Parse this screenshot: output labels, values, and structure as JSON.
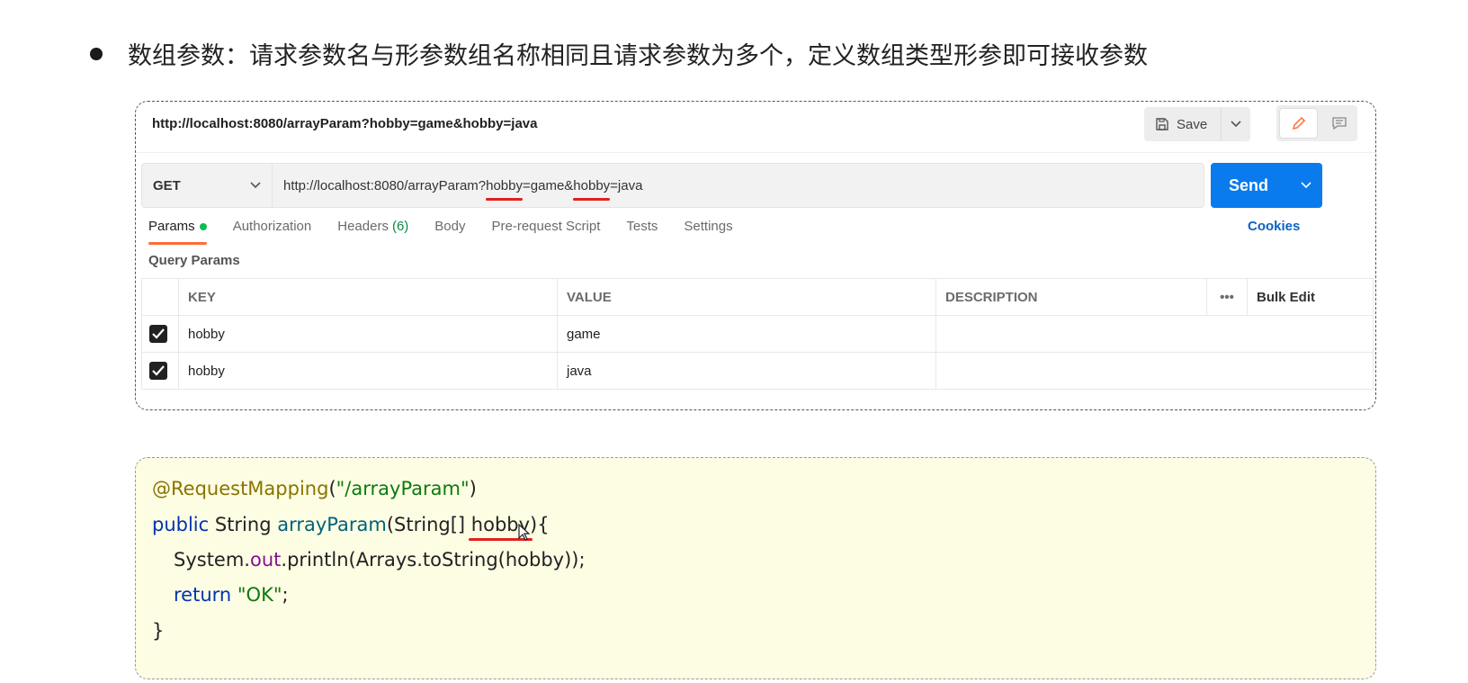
{
  "heading": {
    "text": "数组参数：请求参数名与形参数组名称相同且请求参数为多个，定义数组类型形参即可接收参数"
  },
  "postman": {
    "title_url": "http://localhost:8080/arrayParam?hobby=game&hobby=java",
    "save_label": "Save",
    "method": "GET",
    "url_parts": {
      "prefix": "http://localhost:8080/arrayParam?",
      "key1": "hobby",
      "mid": "=game&",
      "key2": "hobby",
      "suffix": "=java"
    },
    "send_label": "Send",
    "tabs": {
      "params": "Params",
      "authorization": "Authorization",
      "headers": "Headers",
      "headers_count": "(6)",
      "body": "Body",
      "prerequest": "Pre-request Script",
      "tests": "Tests",
      "settings": "Settings"
    },
    "cookies_label": "Cookies",
    "query_params_label": "Query Params",
    "table": {
      "headers": {
        "key": "KEY",
        "value": "VALUE",
        "description": "DESCRIPTION",
        "more": "•••",
        "bulk_edit": "Bulk Edit"
      },
      "rows": [
        {
          "key": "hobby",
          "value": "game",
          "description": "",
          "checked": true
        },
        {
          "key": "hobby",
          "value": "java",
          "description": "",
          "checked": true
        }
      ]
    },
    "colors": {
      "send": "#097bed",
      "active_tab": "#ff6c37",
      "params_dot": "#0cbb52",
      "cookies": "#0b62c4"
    }
  },
  "code": {
    "l1": {
      "anno": "@RequestMapping",
      "open": "(",
      "str": "\"/arrayParam\"",
      "close": ")"
    },
    "l2": {
      "kw": "public",
      "type": " String ",
      "fn": "arrayParam",
      "pre": "(String[] ",
      "param": "hobby",
      "post": "){"
    },
    "l3": {
      "pre": "System.",
      "field": "out",
      "post": ".println(Arrays.toString(hobby));"
    },
    "l4": {
      "kw": "return ",
      "str": "\"OK\"",
      "post": ";"
    },
    "l5": {
      "text": "}"
    },
    "colors": {
      "background": "#fdfde4",
      "annotation": "#8a7400",
      "string": "#0d7a0d",
      "keyword": "#0033b3",
      "method": "#00627a",
      "field": "#871094"
    }
  }
}
